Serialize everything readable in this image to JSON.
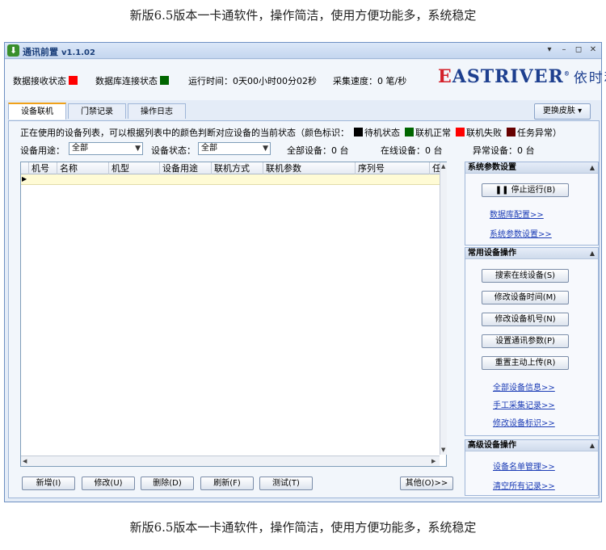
{
  "captions": {
    "top": "新版6.5版本一卡通软件，操作简洁，使用方便功能多，系统稳定",
    "bottom": "新版6.5版本一卡通软件，操作简洁，使用方便功能多，系统稳定"
  },
  "window": {
    "title": "通讯前置",
    "version": "v1.1.02",
    "controls": [
      "▾",
      "–",
      "◻",
      "✕"
    ]
  },
  "status": {
    "recv_label": "数据接收状态",
    "db_label": "数据库连接状态",
    "runtime": "运行时间：0天00小时00分02秒",
    "speed": "采集速度：0 笔/秒",
    "recv_color": "#ff0000",
    "db_color": "#006600"
  },
  "logo": {
    "en_first": "E",
    "en_rest": "ASTRIVER",
    "tm": "®",
    "cn": "依时利"
  },
  "tabs": [
    {
      "label": "设备联机",
      "active": true
    },
    {
      "label": "门禁记录",
      "active": false
    },
    {
      "label": "操作日志",
      "active": false
    }
  ],
  "skin_button": "更换皮肤",
  "legend": {
    "intro": "正在使用的设备列表，可以根据列表中的颜色判断对应设备的当前状态（颜色标识：",
    "items": [
      {
        "label": "待机状态",
        "color": "#000000"
      },
      {
        "label": "联机正常",
        "color": "#006600"
      },
      {
        "label": "联机失败",
        "color": "#ff0000"
      },
      {
        "label": "任务异常）",
        "color": "#660000"
      }
    ]
  },
  "filters": {
    "usage_label": "设备用途：",
    "usage_value": "全部",
    "state_label": "设备状态：",
    "state_value": "全部",
    "all_devices": "全部设备：0 台",
    "online_devices": "在线设备：0 台",
    "abnormal_devices": "异常设备：0 台"
  },
  "grid": {
    "columns": [
      "机号",
      "名称",
      "机型",
      "设备用途",
      "联机方式",
      "联机参数",
      "序列号",
      "任"
    ]
  },
  "bottom_buttons": {
    "add": "新增(I)",
    "edit": "修改(U)",
    "delete": "删除(D)",
    "refresh": "刷新(F)",
    "test": "测试(T)",
    "other": "其他(O)>>"
  },
  "side": {
    "sys": {
      "title": "系统参数设置",
      "stop": "停止运行(B)",
      "db_link": "数据库配置>>",
      "sys_link": "系统参数设置>>"
    },
    "common": {
      "title": "常用设备操作",
      "buttons": [
        "搜索在线设备(S)",
        "修改设备时间(M)",
        "修改设备机号(N)",
        "设置通讯参数(P)",
        "重置主动上传(R)"
      ],
      "links": [
        "全部设备信息>>",
        "手工采集记录>>",
        "修改设备标识>>"
      ]
    },
    "advanced": {
      "title": "高级设备操作",
      "links": [
        "设备名单管理>>",
        "清空所有记录>>"
      ]
    }
  }
}
